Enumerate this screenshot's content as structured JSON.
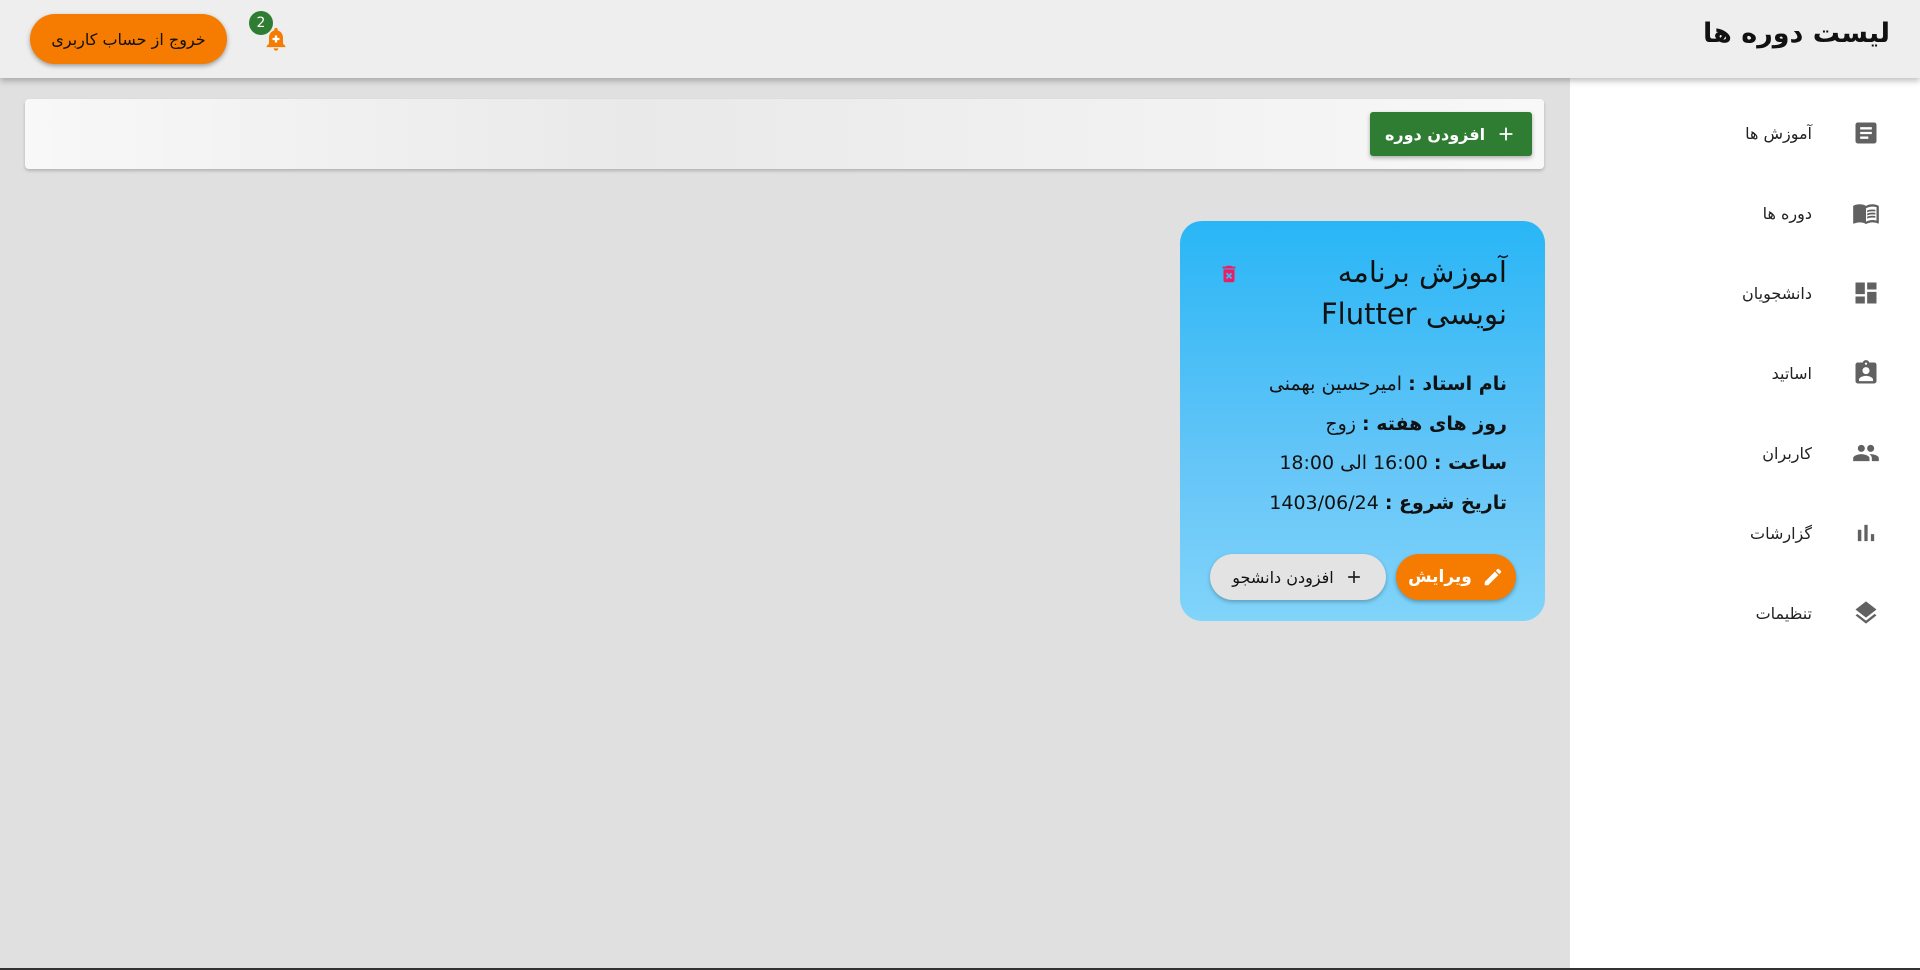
{
  "header": {
    "title": "لیست دوره ها",
    "logout_label": "خروج از حساب کاربری",
    "notification_count": "2"
  },
  "sidebar": {
    "items": [
      {
        "label": "آموزش ها",
        "icon": "article-icon"
      },
      {
        "label": "دوره ها",
        "icon": "book-open-icon"
      },
      {
        "label": "دانشجویان",
        "icon": "dashboard-icon"
      },
      {
        "label": "اساتید",
        "icon": "assignment-ind-icon"
      },
      {
        "label": "کاربران",
        "icon": "people-icon"
      },
      {
        "label": "گزارشات",
        "icon": "bar-chart-icon"
      },
      {
        "label": "تنظیمات",
        "icon": "layers-icon"
      }
    ]
  },
  "toolbar": {
    "add_course_label": "افزودن دوره"
  },
  "course": {
    "title": "آموزش برنامه نویسی Flutter",
    "teacher_label": "نام استاد :",
    "teacher_value": "امیرحسین بهمنی",
    "days_label": "روز های هفته :",
    "days_value": "زوج",
    "time_label": "ساعت :",
    "time_value": "16:00 الی 18:00",
    "start_label": "تاریخ شروع :",
    "start_value": "1403/06/24",
    "edit_label": "ویرایش",
    "add_student_label": "افزودن دانشجو"
  },
  "colors": {
    "accent_orange": "#f57c00",
    "primary_green": "#2e7d32",
    "card_blue": "#29b6f6",
    "delete_red": "#e91e63"
  }
}
